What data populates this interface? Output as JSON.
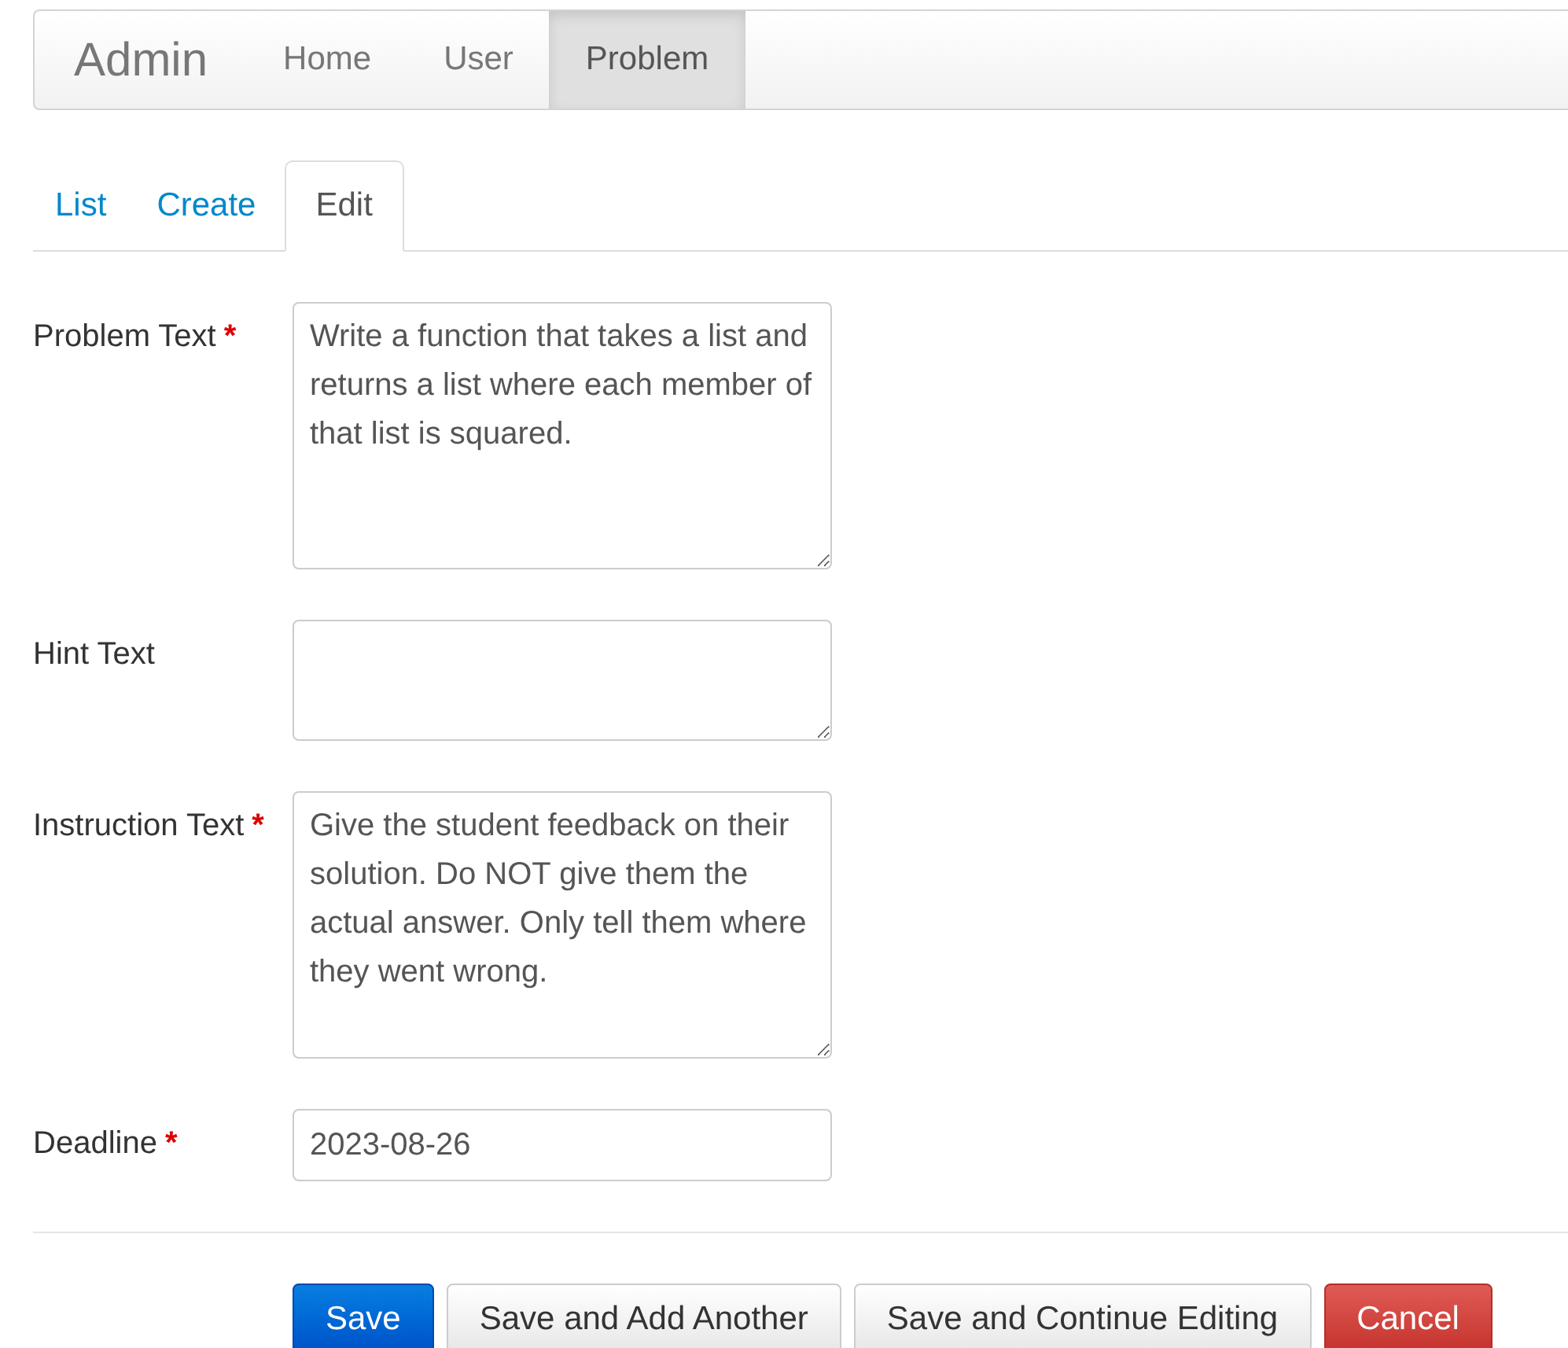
{
  "navbar": {
    "brand": "Admin",
    "items": [
      {
        "label": "Home",
        "selected": false
      },
      {
        "label": "User",
        "selected": false
      },
      {
        "label": "Problem",
        "selected": true
      }
    ]
  },
  "tabs": [
    {
      "label": "List",
      "selected": false
    },
    {
      "label": "Create",
      "selected": false
    },
    {
      "label": "Edit",
      "selected": true
    }
  ],
  "form": {
    "fields": [
      {
        "kind": "tall_textarea",
        "label": "Problem Text",
        "required_mark": "*",
        "value": "Write a function that takes a list and returns a list where each member of that list is squared."
      },
      {
        "kind": "short_textarea",
        "label": "Hint Text"
      },
      {
        "kind": "tall_textarea",
        "label": "Instruction Text",
        "required_mark": "*",
        "value": "Give the student feedback on their solution. Do NOT give them the actual answer. Only tell them where they went wrong."
      },
      {
        "kind": "input",
        "label": "Deadline",
        "required_mark": "*",
        "value": "2023-08-26"
      }
    ]
  },
  "buttons": [
    {
      "label": "Save",
      "kind": "primary"
    },
    {
      "label": "Save and Add Another",
      "kind": "default"
    },
    {
      "label": "Save and Continue Editing",
      "kind": "default"
    },
    {
      "label": "Cancel",
      "kind": "danger"
    }
  ]
}
